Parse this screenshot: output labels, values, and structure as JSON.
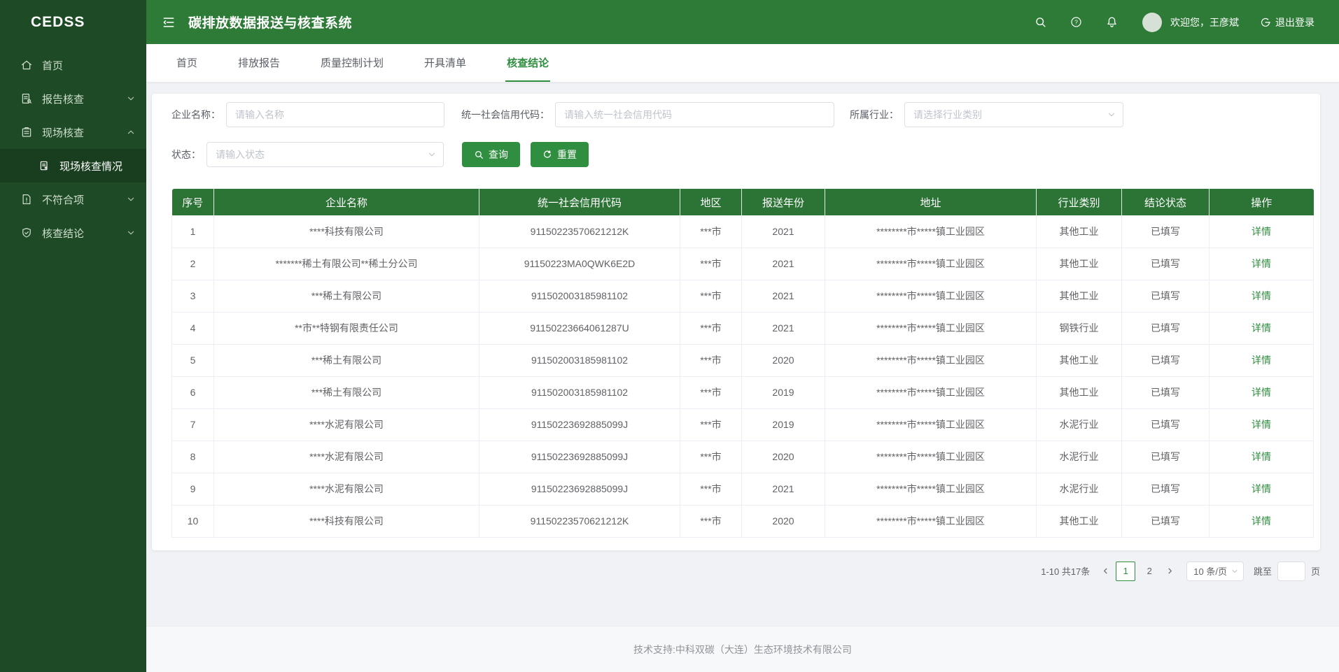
{
  "app": {
    "logo": "CEDSS",
    "title": "碳排放数据报送与核查系统",
    "welcome": "欢迎您，王彦斌",
    "logout_label": "退出登录"
  },
  "sidebar": {
    "items": [
      {
        "id": "home",
        "label": "首页",
        "icon": "home-icon",
        "expandable": false
      },
      {
        "id": "report-check",
        "label": "报告核查",
        "icon": "report-check-icon",
        "expandable": true,
        "expanded": false
      },
      {
        "id": "site-check",
        "label": "现场核查",
        "icon": "site-check-icon",
        "expandable": true,
        "expanded": true,
        "children": [
          {
            "id": "site-check-status",
            "label": "现场核查情况",
            "icon": "doc-icon",
            "active": true
          }
        ]
      },
      {
        "id": "nonconformity",
        "label": "不符合项",
        "icon": "nonconform-icon",
        "expandable": true,
        "expanded": false
      },
      {
        "id": "conclusion",
        "label": "核查结论",
        "icon": "conclusion-icon",
        "expandable": true,
        "expanded": false
      }
    ]
  },
  "tabs": {
    "items": [
      "首页",
      "排放报告",
      "质量控制计划",
      "开具清单",
      "核查结论"
    ],
    "active_index": 4
  },
  "filters": {
    "name_label": "企业名称：",
    "name_placeholder": "请输入名称",
    "code_label": "统一社会信用代码：",
    "code_placeholder": "请输入统一社会信用代码",
    "industry_label": "所属行业：",
    "industry_placeholder": "请选择行业类别",
    "status_label": "状态：",
    "status_placeholder": "请输入状态",
    "search_button": "查询",
    "reset_button": "重置"
  },
  "table": {
    "headers": [
      "序号",
      "企业名称",
      "统一社会信用代码",
      "地区",
      "报送年份",
      "地址",
      "行业类别",
      "结论状态",
      "操作"
    ],
    "action_label": "详情",
    "rows": [
      {
        "no": "1",
        "name": "****科技有限公司",
        "code": "91150223570621212K",
        "region": "***市",
        "year": "2021",
        "address": "********市*****镇工业园区",
        "industry": "其他工业",
        "status": "已填写"
      },
      {
        "no": "2",
        "name": "*******稀土有限公司**稀土分公司",
        "code": "91150223MA0QWK6E2D",
        "region": "***市",
        "year": "2021",
        "address": "********市*****镇工业园区",
        "industry": "其他工业",
        "status": "已填写"
      },
      {
        "no": "3",
        "name": "***稀土有限公司",
        "code": "911502003185981102",
        "region": "***市",
        "year": "2021",
        "address": "********市*****镇工业园区",
        "industry": "其他工业",
        "status": "已填写"
      },
      {
        "no": "4",
        "name": "**市**特钢有限责任公司",
        "code": "91150223664061287U",
        "region": "***市",
        "year": "2021",
        "address": "********市*****镇工业园区",
        "industry": "钢铁行业",
        "status": "已填写"
      },
      {
        "no": "5",
        "name": "***稀土有限公司",
        "code": "911502003185981102",
        "region": "***市",
        "year": "2020",
        "address": "********市*****镇工业园区",
        "industry": "其他工业",
        "status": "已填写"
      },
      {
        "no": "6",
        "name": "***稀土有限公司",
        "code": "911502003185981102",
        "region": "***市",
        "year": "2019",
        "address": "********市*****镇工业园区",
        "industry": "其他工业",
        "status": "已填写"
      },
      {
        "no": "7",
        "name": "****水泥有限公司",
        "code": "91150223692885099J",
        "region": "***市",
        "year": "2019",
        "address": "********市*****镇工业园区",
        "industry": "水泥行业",
        "status": "已填写"
      },
      {
        "no": "8",
        "name": "****水泥有限公司",
        "code": "91150223692885099J",
        "region": "***市",
        "year": "2020",
        "address": "********市*****镇工业园区",
        "industry": "水泥行业",
        "status": "已填写"
      },
      {
        "no": "9",
        "name": "****水泥有限公司",
        "code": "91150223692885099J",
        "region": "***市",
        "year": "2021",
        "address": "********市*****镇工业园区",
        "industry": "水泥行业",
        "status": "已填写"
      },
      {
        "no": "10",
        "name": "****科技有限公司",
        "code": "91150223570621212K",
        "region": "***市",
        "year": "2020",
        "address": "********市*****镇工业园区",
        "industry": "其他工业",
        "status": "已填写"
      }
    ]
  },
  "pagination": {
    "total_text": "1-10 共17条",
    "pages": [
      "1",
      "2"
    ],
    "active_page": "1",
    "size_text": "10 条/页",
    "jump_label": "跳至",
    "page_unit": "页"
  },
  "footer": {
    "text": "技术支持:中科双碳（大连）生态环境技术有限公司"
  },
  "colors": {
    "sidebar": "#1e4b26",
    "header": "#2e7b38",
    "accent": "#2f8e3f",
    "table_header": "#2c7436"
  }
}
